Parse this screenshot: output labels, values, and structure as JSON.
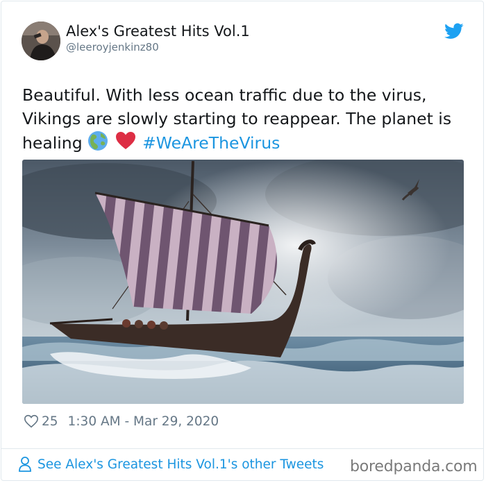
{
  "tweet": {
    "display_name": "Alex's Greatest Hits Vol.1",
    "handle": "@leeroyjenkinz80",
    "text_line1": "Beautiful. With less ocean traffic due to the virus,",
    "text_line2": "Vikings are slowly starting to reappear. The planet is",
    "text_line3": "healing",
    "hashtag": "#WeAreTheVirus",
    "like_count": "25",
    "timestamp": "1:30 AM - Mar 29, 2020",
    "emojis": [
      "globe-americas",
      "red-heart"
    ]
  },
  "footer": {
    "link_text": "See Alex's Greatest Hits Vol.1's other Tweets"
  },
  "watermark": "boredpanda.com",
  "colors": {
    "link": "#1b95e0",
    "text": "#14171a",
    "secondary": "#657786",
    "border": "#e1e8ed",
    "twitter_blue": "#1da1f2"
  }
}
